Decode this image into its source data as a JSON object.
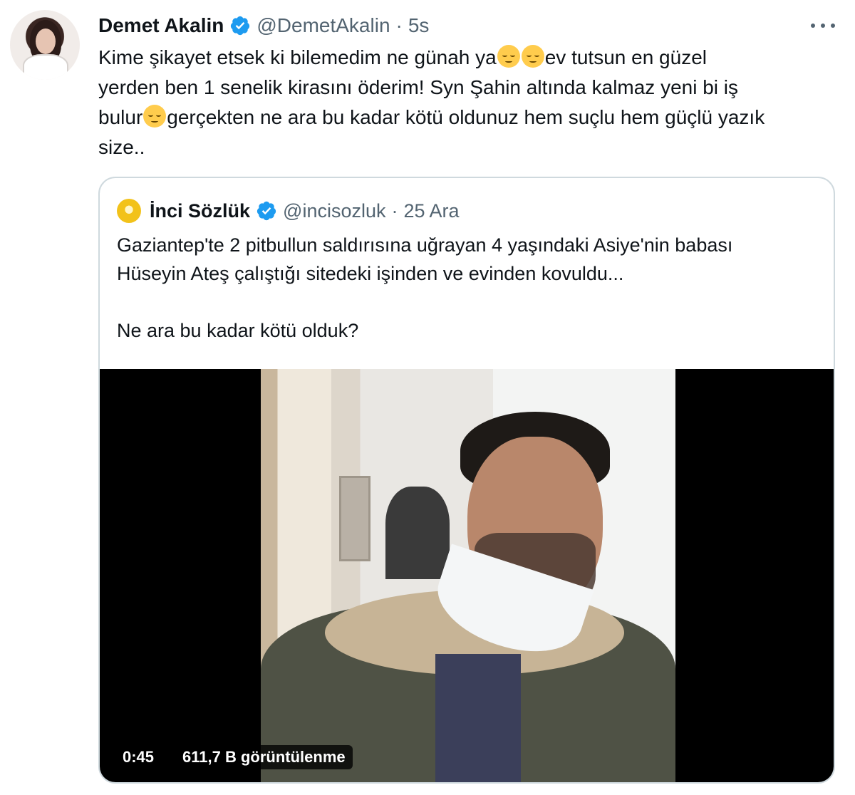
{
  "tweet": {
    "author": {
      "name": "Demet Akalin",
      "handle": "@DemetAkalin",
      "separator": "·",
      "time": "5s"
    },
    "text_lines": [
      {
        "a": "Kime şikayet etsek ki bilemedim ne günah ya",
        "b": "ev tutsun en güzel"
      },
      {
        "a": "yerden ben 1 senelik kirasını öderim! Syn Şahin altında kalmaz yeni bi iş"
      },
      {
        "a": "bulur",
        "b": "gerçekten ne ara bu kadar kötü oldunuz hem suçlu hem güçlü yazık"
      },
      {
        "a": "size.."
      }
    ],
    "emoji": "relieved-face-emoji"
  },
  "quoted_tweet": {
    "author": {
      "name": "İnci Sözlük",
      "handle": "@incisozluk",
      "separator": "·",
      "time": "25 Ara"
    },
    "text_lines": [
      "Gaziantep'te 2 pitbullun saldırısına uğrayan 4 yaşındaki Asiye'nin babası",
      "Hüseyin Ateş çalıştığı sitedeki işinden ve evinden kovuldu...",
      "",
      "Ne ara bu kadar kötü olduk?"
    ],
    "video": {
      "duration": "0:45",
      "views": "611,7 B görüntülenme"
    }
  },
  "colors": {
    "verified": "#1d9bf0",
    "secondary_text": "#536471",
    "border": "#cfd9de"
  }
}
